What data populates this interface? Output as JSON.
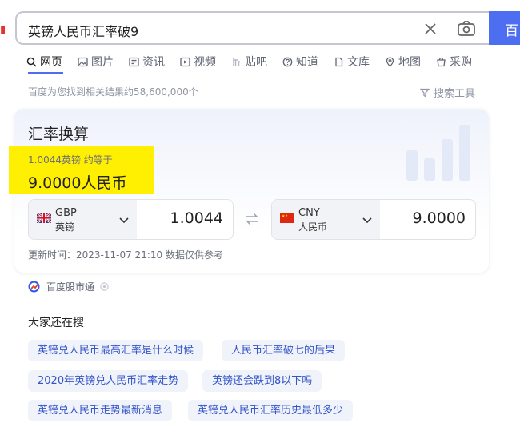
{
  "search": {
    "query": "英镑人民币汇率破9",
    "button_label": "百"
  },
  "tabs": [
    {
      "label": "网页",
      "icon": "search-icon"
    },
    {
      "label": "图片",
      "icon": "image-icon"
    },
    {
      "label": "资讯",
      "icon": "news-icon"
    },
    {
      "label": "视频",
      "icon": "video-icon"
    },
    {
      "label": "贴吧",
      "icon": "tieba-icon"
    },
    {
      "label": "知道",
      "icon": "question-icon"
    },
    {
      "label": "文库",
      "icon": "document-icon"
    },
    {
      "label": "地图",
      "icon": "map-icon"
    },
    {
      "label": "采购",
      "icon": "cart-icon"
    }
  ],
  "results": {
    "count_text": "百度为您找到相关结果约58,600,000个",
    "tools_label": "搜索工具"
  },
  "card": {
    "title": "汇率换算",
    "rate_line": "1.0044英镑 约等于",
    "rate_result": "9.0000人民币",
    "from": {
      "code": "GBP",
      "name": "英镑",
      "amount": "1.0044"
    },
    "to": {
      "code": "CNY",
      "name": "人民币",
      "amount": "9.0000"
    },
    "update_time": "更新时间：2023-11-07 21:10 数据仅供参考"
  },
  "source": {
    "label": "百度股市通"
  },
  "related": {
    "title": "大家还在搜",
    "items": [
      "英镑兑人民币最高汇率是什么时候",
      "人民币汇率破七的后果",
      "2020年英镑兑人民币汇率走势",
      "英镑还会跌到8以下吗",
      "英镑兑人民币走势最新消息",
      "英镑兑人民币汇率历史最低多少"
    ]
  },
  "colors": {
    "accent": "#4e6ef2",
    "highlight": "#ffef00",
    "chip_text": "#3355c8"
  }
}
